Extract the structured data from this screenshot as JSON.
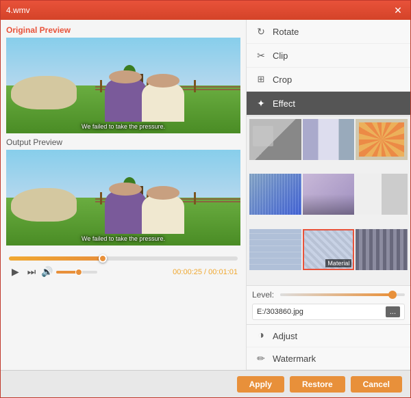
{
  "window": {
    "title": "4.wmv",
    "close_label": "✕"
  },
  "left_panel": {
    "original_label": "Original Preview",
    "output_label": "Output Preview",
    "subtitle": "We failed to take the pressure.",
    "time_current": "00:00:25",
    "time_total": "00:01:01",
    "time_separator": " / "
  },
  "right_panel": {
    "tools": [
      {
        "id": "rotate",
        "label": "Rotate",
        "icon": "↻"
      },
      {
        "id": "clip",
        "label": "Clip",
        "icon": "✂"
      },
      {
        "id": "crop",
        "label": "Crop",
        "icon": "⊞"
      },
      {
        "id": "effect",
        "label": "Effect",
        "icon": "✦",
        "active": true
      }
    ],
    "effects": [
      {
        "id": 1,
        "class": "thumb-1",
        "label": ""
      },
      {
        "id": 2,
        "class": "thumb-2",
        "label": ""
      },
      {
        "id": 3,
        "class": "thumb-3",
        "label": ""
      },
      {
        "id": 4,
        "class": "thumb-4",
        "label": ""
      },
      {
        "id": 5,
        "class": "thumb-5",
        "label": ""
      },
      {
        "id": 6,
        "class": "thumb-6",
        "label": ""
      },
      {
        "id": 7,
        "class": "thumb-7",
        "label": ""
      },
      {
        "id": 8,
        "class": "thumb-8",
        "label": "Material",
        "selected": true
      },
      {
        "id": 9,
        "class": "thumb-9",
        "label": ""
      }
    ],
    "level_label": "Level:",
    "file_path": "E:/303860.jpg",
    "browse_label": "...",
    "bottom_tools": [
      {
        "id": "adjust",
        "label": "Adjust",
        "icon": "◑"
      },
      {
        "id": "watermark",
        "label": "Watermark",
        "icon": "✏"
      }
    ]
  },
  "footer": {
    "apply_label": "Apply",
    "restore_label": "Restore",
    "cancel_label": "Cancel"
  }
}
